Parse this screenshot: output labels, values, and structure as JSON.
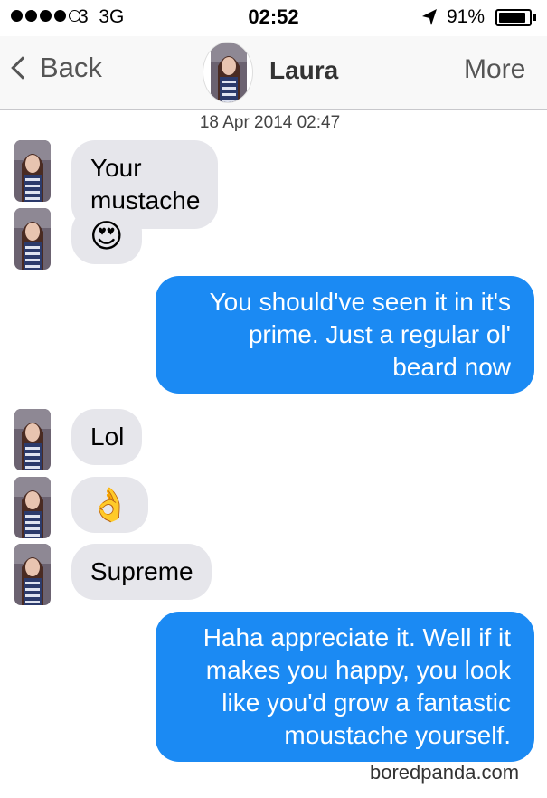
{
  "status_bar": {
    "carrier": "3",
    "network": "3G",
    "time": "02:52",
    "battery_percent": "91%",
    "battery_level": 0.91
  },
  "nav": {
    "back_label": "Back",
    "contact_name": "Laura",
    "more_label": "More"
  },
  "timestamp": "18 Apr 2014 02:47",
  "messages": [
    {
      "from": "Laura",
      "text": "Your mustache"
    },
    {
      "from": "Laura",
      "text": "😍",
      "icon": "heart-eyes-emoji"
    },
    {
      "from": "me",
      "lines": [
        "You should've seen it in it's",
        "prime. Just a regular ol'",
        "beard now"
      ]
    },
    {
      "from": "Laura",
      "text": "Lol"
    },
    {
      "from": "Laura",
      "text": "👌",
      "icon": "ok-hand-emoji"
    },
    {
      "from": "Laura",
      "text": "Supreme"
    },
    {
      "from": "me",
      "lines": [
        "Haha appreciate it. Well if it",
        "makes you happy, you look",
        "like you'd grow a fantastic",
        "moustache yourself."
      ]
    }
  ],
  "colors": {
    "outgoing_bubble": "#1b8af3",
    "incoming_bubble": "#e6e6eb"
  },
  "watermark": "boredpanda.com"
}
